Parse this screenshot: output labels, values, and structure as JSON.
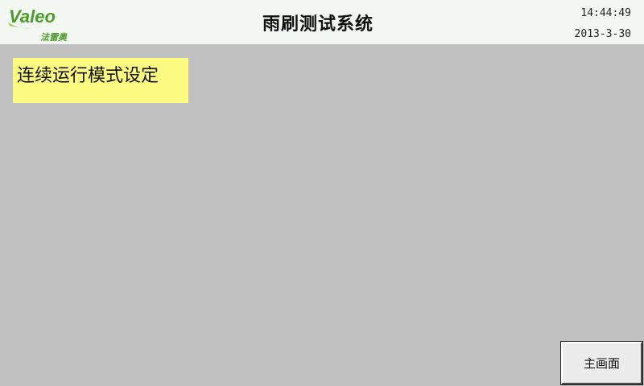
{
  "header": {
    "logo": {
      "brand": "Valeo",
      "subtitle": "法雷奥",
      "brand_color": "#4c9a2a",
      "accent_color": "#8dc63f"
    },
    "title": "雨刷测试系统",
    "time": "14:44:49",
    "date": "2013-3-30"
  },
  "main": {
    "mode_label": "连续运行模式设定"
  },
  "footer": {
    "home_button_label": "主画面"
  },
  "colors": {
    "background": "#c0c0c0",
    "header_bg": "#f2f7f2",
    "mode_box_bg": "#fbfb82"
  }
}
